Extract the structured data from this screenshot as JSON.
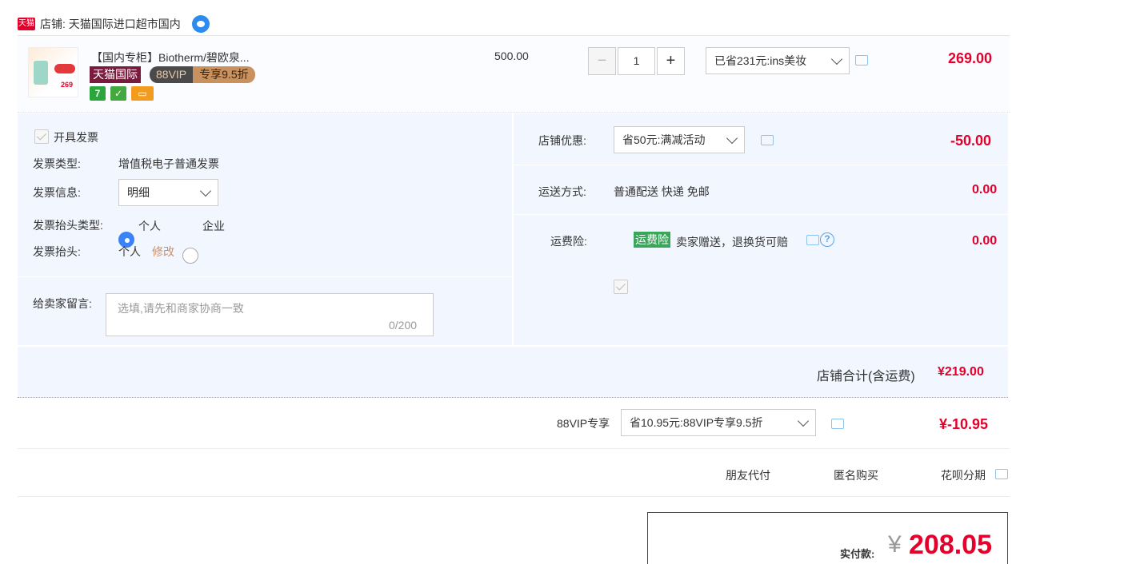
{
  "shop": {
    "badge": "天猫",
    "label": "店铺: 天猫国际进口超市国内"
  },
  "product": {
    "title": "【国内专柜】Biotherm/碧欧泉...",
    "thumb_price": "269",
    "tag_tmall": "天猫国际",
    "tag_vip_a": "88VIP",
    "tag_vip_b": "专享9.5折",
    "mini_icon_1": "7",
    "unit_price": "500.00",
    "quantity": "1",
    "discount_select": "已省231元:ins美妆",
    "total": "269.00"
  },
  "invoice": {
    "checkbox_label": "开具发票",
    "type_label": "发票类型:",
    "type_value": "增值税电子普通发票",
    "info_label": "发票信息:",
    "info_value": "明细",
    "head_type_label": "发票抬头类型:",
    "option_personal": "个人",
    "option_company": "企业",
    "head_label": "发票抬头:",
    "head_value": "个人",
    "edit": "修改"
  },
  "message": {
    "label": "给卖家留言:",
    "placeholder": "选填,请先和商家协商一致",
    "count": "0/200"
  },
  "shop_discount": {
    "label": "店铺优惠:",
    "select": "省50元:满减活动",
    "value": "-50.00"
  },
  "shipping": {
    "label": "运送方式:",
    "value": "普通配送 快递 免邮",
    "price": "0.00"
  },
  "insurance": {
    "label": "运费险:",
    "badge": "运费险",
    "desc": "卖家赠送，退换货可赔",
    "help": "?",
    "price": "0.00"
  },
  "shop_total": {
    "label": "店铺合计(含运费)",
    "value": "¥219.00"
  },
  "vip": {
    "label": "88VIP专享",
    "select": "省10.95元:88VIP专享9.5折",
    "value": "¥-10.95"
  },
  "options": {
    "friend_pay": "朋友代付",
    "anonymous": "匿名购买",
    "huabei": "花呗分期"
  },
  "pay": {
    "label": "实付款:",
    "currency": "¥",
    "value": "208.05"
  },
  "colors": {
    "accent_red": "#e4002b",
    "panel_bg": "#f1f6ff",
    "blue_check": "#3b82f6"
  }
}
